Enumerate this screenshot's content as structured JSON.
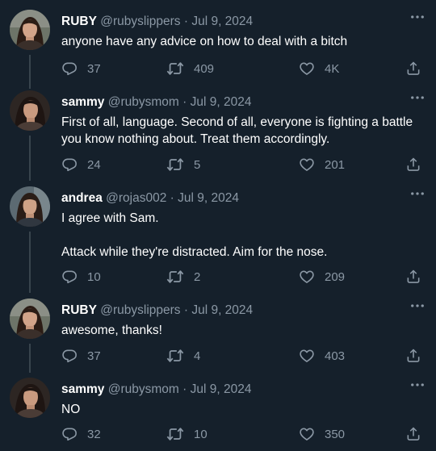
{
  "tweets": [
    {
      "name": "RUBY",
      "handle": "@rubyslippers",
      "date": "Jul 9, 2024",
      "text": [
        "anyone have any advice on how to deal with a bitch"
      ],
      "replies": "37",
      "retweets": "409",
      "likes": "4K"
    },
    {
      "name": "sammy",
      "handle": "@rubysmom",
      "date": "Jul 9, 2024",
      "text": [
        "First of all, language. Second of all, everyone is fighting a battle you know nothing about. Treat them accordingly."
      ],
      "replies": "24",
      "retweets": "5",
      "likes": "201"
    },
    {
      "name": "andrea",
      "handle": "@rojas002",
      "date": "Jul 9, 2024",
      "text": [
        "I agree with Sam.",
        "Attack while they're distracted. Aim for the nose."
      ],
      "replies": "10",
      "retweets": "2",
      "likes": "209"
    },
    {
      "name": "RUBY",
      "handle": "@rubyslippers",
      "date": "Jul 9, 2024",
      "text": [
        "awesome, thanks!"
      ],
      "replies": "37",
      "retweets": "4",
      "likes": "403"
    },
    {
      "name": "sammy",
      "handle": "@rubysmom",
      "date": "Jul 9, 2024",
      "text": [
        "NO"
      ],
      "replies": "32",
      "retweets": "10",
      "likes": "350"
    }
  ],
  "separator": "·",
  "icons": {
    "reply": "reply-icon",
    "retweet": "retweet-icon",
    "like": "heart-icon",
    "share": "share-icon",
    "more": "more-icon"
  },
  "colors": {
    "background": "#15202b",
    "muted": "#8b98a5",
    "thread_line": "#38444d"
  }
}
